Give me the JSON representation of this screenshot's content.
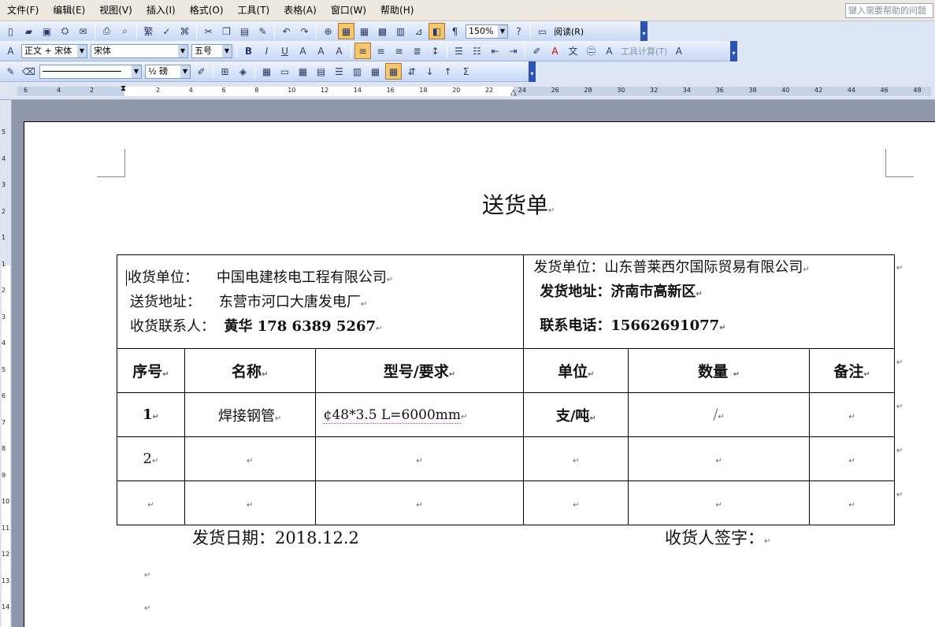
{
  "menu": [
    "文件(F)",
    "编辑(E)",
    "视图(V)",
    "插入(I)",
    "格式(O)",
    "工具(T)",
    "表格(A)",
    "窗口(W)",
    "帮助(H)"
  ],
  "help_placeholder": "键入需要帮助的问题",
  "toolbar": {
    "zoom": "150%",
    "read_label": "阅读(R)",
    "style": "正文 + 宋体",
    "font": "宋体",
    "size": "五号",
    "calc_label": "工具计算(T)",
    "line_weight": "½ 磅"
  },
  "ruler": {
    "h_left": [
      "6",
      "4",
      "2"
    ],
    "h_right": [
      "2",
      "4",
      "6",
      "8",
      "10",
      "12",
      "14",
      "16",
      "18",
      "20",
      "22",
      "24",
      "26",
      "28",
      "30",
      "32",
      "34",
      "36",
      "38",
      "40",
      "42",
      "44",
      "46",
      "48"
    ],
    "v": [
      "5",
      "4",
      "3",
      "2",
      "1",
      "1",
      "2",
      "3",
      "4",
      "5",
      "6",
      "7",
      "8",
      "9",
      "10",
      "11",
      "12",
      "13",
      "14"
    ]
  },
  "doc": {
    "title": "送货单",
    "receiver_unit_label": "收货单位：",
    "receiver_unit": "中国电建核电工程有限公司",
    "receiver_addr_label": "送货地址：",
    "receiver_addr": "东营市河口大唐发电厂",
    "receiver_contact_label": "收货联系人：",
    "receiver_contact": "黄华 178 6389 5267",
    "sender_unit_label": "发货单位：",
    "sender_unit": "山东普莱西尔国际贸易有限公司",
    "sender_addr_label": "发货地址：",
    "sender_addr": "济南市高新区",
    "sender_phone_label": "联系电话：",
    "sender_phone": "15662691077",
    "headers": [
      "序号",
      "名称",
      "型号/要求",
      "单位",
      "数量",
      "备注"
    ],
    "rows": [
      {
        "no": "1",
        "name": "焊接钢管",
        "model": "¢48*3.5 L=6000mm",
        "unit": "支/吨",
        "qty": "/",
        "note": ""
      },
      {
        "no": "2",
        "name": "",
        "model": "",
        "unit": "",
        "qty": "",
        "note": ""
      },
      {
        "no": "",
        "name": "",
        "model": "",
        "unit": "",
        "qty": "",
        "note": ""
      }
    ],
    "ship_date_label": "发货日期：",
    "ship_date": "2018.12.2",
    "signature_label": "收货人签字："
  },
  "colors": {
    "toolbar": "#c7d8f5",
    "workspace": "#8f98ab",
    "active_button": "#f6c66a"
  }
}
